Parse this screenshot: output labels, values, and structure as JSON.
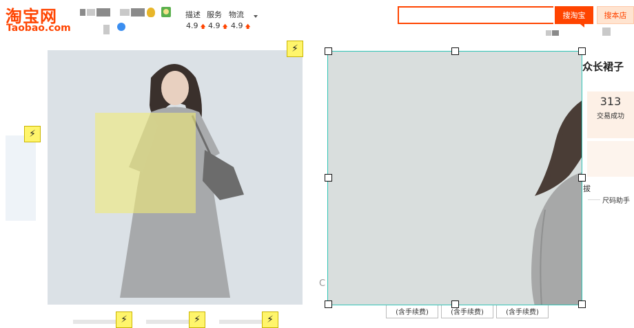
{
  "header": {
    "logo_cn": "淘宝网",
    "logo_en": "Taobao.com",
    "ratings": [
      {
        "label": "描述",
        "value": "4.9"
      },
      {
        "label": "服务",
        "value": "4.9"
      },
      {
        "label": "物流",
        "value": "4.9"
      }
    ],
    "up_arrow": "🡅"
  },
  "search": {
    "placeholder": "",
    "button_label": "搜淘宝",
    "store_button_label": "搜本店"
  },
  "product": {
    "title_fragment": "众长裙子",
    "stats_value": "313",
    "stats_label": "交易成功",
    "fragment_char": "拔",
    "size_helper": "尺码助手",
    "c_fragment": "C",
    "fee_buttons": [
      "(含手续费)",
      "(含手续费)",
      "(含手续费)"
    ]
  },
  "icons": {
    "bolt": "⚡"
  },
  "colors": {
    "brand": "#ff4400",
    "selection_border": "#2ec4b6",
    "bolt_badge": "#fff56b"
  }
}
